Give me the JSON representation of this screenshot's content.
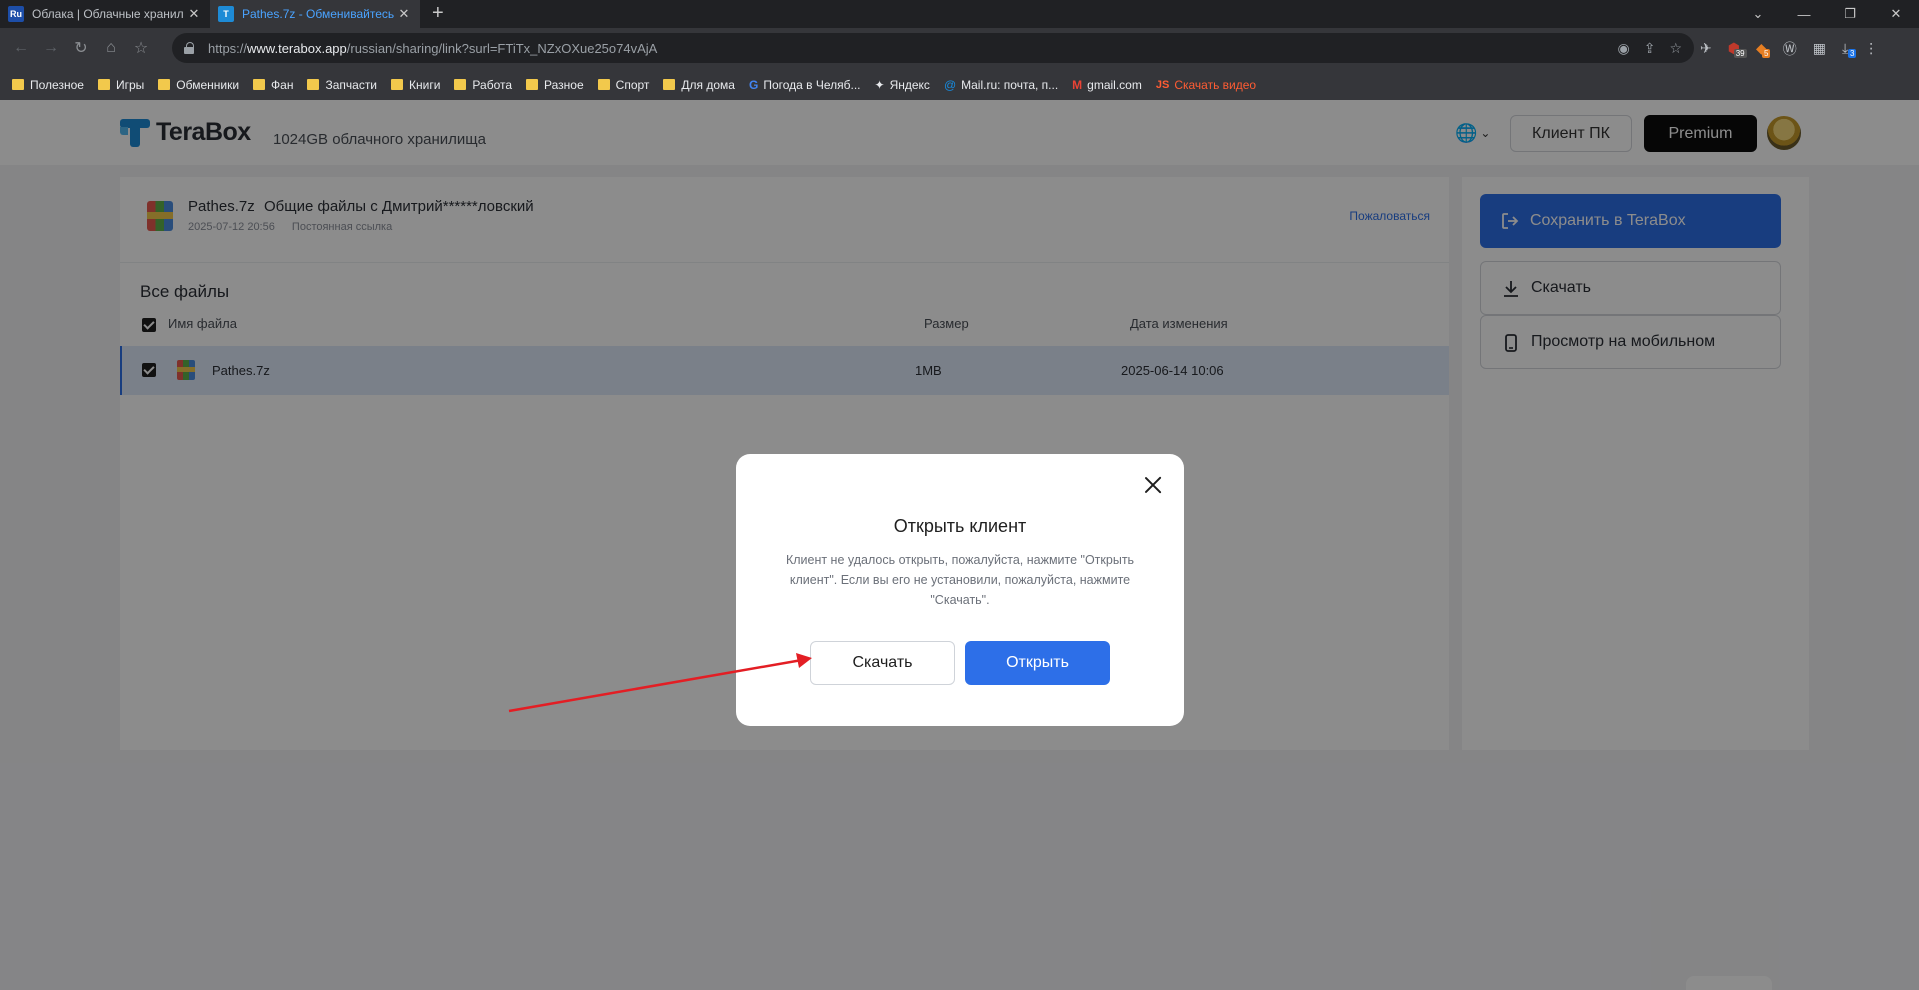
{
  "browser": {
    "tabs": [
      {
        "favicon": "Ru",
        "title": "Облака | Облачные хранил",
        "active": false
      },
      {
        "favicon": "T",
        "title": "Pathes.7z - Обменивайтесь",
        "active": true
      }
    ],
    "url_prefix": "https://",
    "url_host": "www.terabox.app",
    "url_path": "/russian/sharing/link?surl=FTiTx_NZxOXue25o74vAjA",
    "extension_badges": [
      "39",
      "5",
      "3"
    ],
    "bookmarks": [
      {
        "label": "Полезное",
        "icon": "folder-icon"
      },
      {
        "label": "Игры",
        "icon": "folder-icon"
      },
      {
        "label": "Обменники",
        "icon": "folder-icon"
      },
      {
        "label": "Фан",
        "icon": "folder-icon"
      },
      {
        "label": "Запчасти",
        "icon": "folder-icon"
      },
      {
        "label": "Книги",
        "icon": "folder-icon"
      },
      {
        "label": "Работа",
        "icon": "folder-icon"
      },
      {
        "label": "Разное",
        "icon": "folder-icon"
      },
      {
        "label": "Спорт",
        "icon": "folder-icon"
      },
      {
        "label": "Для дома",
        "icon": "folder-icon"
      },
      {
        "label": "Погода в Челяб...",
        "icon": "google-icon"
      },
      {
        "label": "Яндекс",
        "icon": "yandex-icon"
      },
      {
        "label": "Mail.ru: почта, п...",
        "icon": "mailru-icon"
      },
      {
        "label": "gmail.com",
        "icon": "gmail-icon"
      },
      {
        "label": "Скачать видео",
        "icon": "js-icon"
      }
    ]
  },
  "header": {
    "logo": "TeraBox",
    "storage": "1024GB облачного хранилища",
    "pc_client": "Клиент ПК",
    "premium": "Premium"
  },
  "share": {
    "file_name": "Pathes.7z",
    "shared_by": "Общие файлы с Дмитрий******ловский",
    "date": "2025-07-12 20:56",
    "link_type": "Постоянная ссылка",
    "report": "Пожаловаться"
  },
  "files": {
    "title": "Все файлы",
    "columns": {
      "name": "Имя файла",
      "size": "Размер",
      "modified": "Дата изменения"
    },
    "rows": [
      {
        "name": "Pathes.7z",
        "size": "1MB",
        "modified": "2025-06-14 10:06",
        "checked": true
      }
    ]
  },
  "side": {
    "save": "Сохранить в TeraBox",
    "download": "Скачать",
    "mobile": "Просмотр на мобильном"
  },
  "dialog": {
    "title": "Открыть клиент",
    "text": "Клиент не удалось открыть, пожалуйста, нажмите \"Открыть клиент\". Если вы его не установили, пожалуйста, нажмите \"Скачать\".",
    "download": "Скачать",
    "open": "Открыть"
  },
  "colors": {
    "accent": "#2d6fe8",
    "annotation_arrow": "#e31e24"
  }
}
